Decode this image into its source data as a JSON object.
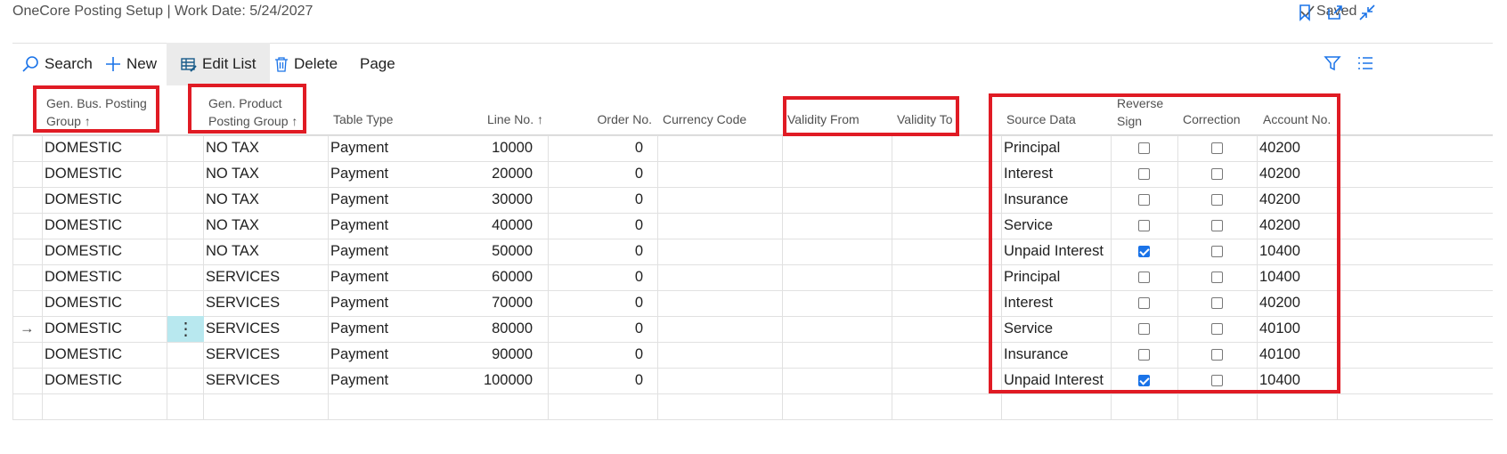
{
  "header": {
    "title": "OneCore Posting Setup | Work Date: 5/24/2027",
    "saved_label": "Saved"
  },
  "toolbar": {
    "search_label": "Search",
    "new_label": "New",
    "edit_list_label": "Edit List",
    "delete_label": "Delete",
    "page_label": "Page"
  },
  "columns": {
    "gen_bus_posting_group": "Gen. Bus. Posting Group ↑",
    "gen_prod_posting_group": "Gen. Product Posting Group ↑",
    "table_type": "Table Type",
    "line_no": "Line No. ↑",
    "order_no": "Order No.",
    "currency_code": "Currency Code",
    "validity_from": "Validity From",
    "validity_to": "Validity To",
    "source_data": "Source Data",
    "reverse_sign": "Reverse Sign",
    "correction": "Correction",
    "account_no": "Account No."
  },
  "rows": [
    {
      "bus": "DOMESTIC",
      "prod": "NO TAX",
      "type": "Payment",
      "line": "10000",
      "order": "0",
      "source": "Principal",
      "reverse": false,
      "correction": false,
      "account": "40200"
    },
    {
      "bus": "DOMESTIC",
      "prod": "NO TAX",
      "type": "Payment",
      "line": "20000",
      "order": "0",
      "source": "Interest",
      "reverse": false,
      "correction": false,
      "account": "40200"
    },
    {
      "bus": "DOMESTIC",
      "prod": "NO TAX",
      "type": "Payment",
      "line": "30000",
      "order": "0",
      "source": "Insurance",
      "reverse": false,
      "correction": false,
      "account": "40200"
    },
    {
      "bus": "DOMESTIC",
      "prod": "NO TAX",
      "type": "Payment",
      "line": "40000",
      "order": "0",
      "source": "Service",
      "reverse": false,
      "correction": false,
      "account": "40200"
    },
    {
      "bus": "DOMESTIC",
      "prod": "NO TAX",
      "type": "Payment",
      "line": "50000",
      "order": "0",
      "source": "Unpaid Interest",
      "reverse": true,
      "correction": false,
      "account": "10400"
    },
    {
      "bus": "DOMESTIC",
      "prod": "SERVICES",
      "type": "Payment",
      "line": "60000",
      "order": "0",
      "source": "Principal",
      "reverse": false,
      "correction": false,
      "account": "10400"
    },
    {
      "bus": "DOMESTIC",
      "prod": "SERVICES",
      "type": "Payment",
      "line": "70000",
      "order": "0",
      "source": "Interest",
      "reverse": false,
      "correction": false,
      "account": "40200"
    },
    {
      "bus": "DOMESTIC",
      "prod": "SERVICES",
      "type": "Payment",
      "line": "80000",
      "order": "0",
      "source": "Service",
      "reverse": false,
      "correction": false,
      "account": "40100",
      "selected": true
    },
    {
      "bus": "DOMESTIC",
      "prod": "SERVICES",
      "type": "Payment",
      "line": "90000",
      "order": "0",
      "source": "Insurance",
      "reverse": false,
      "correction": false,
      "account": "40100"
    },
    {
      "bus": "DOMESTIC",
      "prod": "SERVICES",
      "type": "Payment",
      "line": "100000",
      "order": "0",
      "source": "Unpaid Interest",
      "reverse": true,
      "correction": false,
      "account": "10400"
    }
  ],
  "icons": {
    "selected_row_marker": "→",
    "row_menu": "⋮"
  },
  "colors": {
    "highlight_box": "#e01b24",
    "accent": "#1a73e8",
    "selected_menu_cell": "#b8e8ef"
  }
}
